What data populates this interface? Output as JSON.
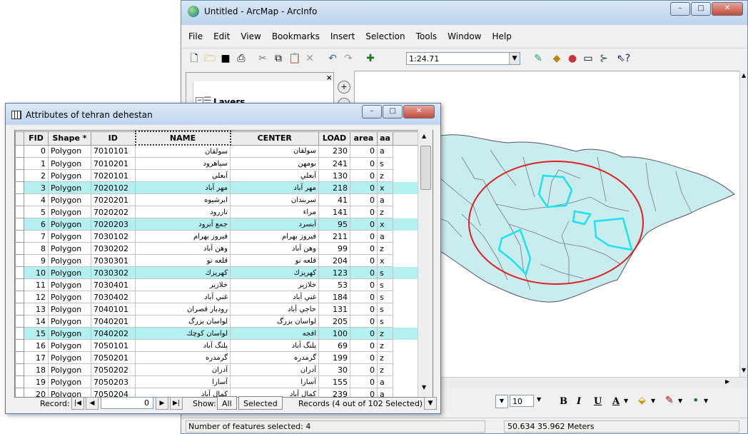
{
  "arcmap": {
    "title": "Untitled - ArcMap - ArcInfo",
    "window_buttons": [
      "–",
      "□",
      "✕"
    ],
    "menus": [
      "File",
      "Edit",
      "View",
      "Bookmarks",
      "Insert",
      "Selection",
      "Tools",
      "Window",
      "Help"
    ],
    "scale": "1:24.71",
    "toc_layers_label": "Layers",
    "font_size": "10",
    "format_bold": "B",
    "format_italic": "I",
    "format_underline": "U",
    "format_font_color": "A",
    "status_selected": "Number of features selected: 4",
    "status_coords": "50.634  35.962 Meters"
  },
  "attributes": {
    "title": "Attributes of tehran dehestan",
    "window_buttons": [
      "–",
      "□",
      "✕"
    ],
    "columns": [
      "FID",
      "Shape *",
      "ID",
      "NAME",
      "CENTER",
      "LOAD",
      "area",
      "aa"
    ],
    "rows": [
      {
        "fid": "0",
        "shape": "Polygon",
        "id": "7010101",
        "name": "سولقان",
        "center": "سولقان",
        "load": "230",
        "area": "0",
        "aa": "a",
        "hi": false
      },
      {
        "fid": "1",
        "shape": "Polygon",
        "id": "7010201",
        "name": "سیاهرود",
        "center": "بومهن",
        "load": "241",
        "area": "0",
        "aa": "s",
        "hi": false
      },
      {
        "fid": "2",
        "shape": "Polygon",
        "id": "7020101",
        "name": "آبعلي",
        "center": "آبعلي",
        "load": "130",
        "area": "0",
        "aa": "z",
        "hi": false
      },
      {
        "fid": "3",
        "shape": "Polygon",
        "id": "7020102",
        "name": "مهر آباد",
        "center": "مهر آباد",
        "load": "218",
        "area": "0",
        "aa": "x",
        "hi": true
      },
      {
        "fid": "4",
        "shape": "Polygon",
        "id": "7020201",
        "name": "ابرشیوه",
        "center": "سربندان",
        "load": "41",
        "area": "0",
        "aa": "a",
        "hi": false
      },
      {
        "fid": "5",
        "shape": "Polygon",
        "id": "7020202",
        "name": "تاررود",
        "center": "مراء",
        "load": "141",
        "area": "0",
        "aa": "z",
        "hi": false
      },
      {
        "fid": "6",
        "shape": "Polygon",
        "id": "7020203",
        "name": "جمع آبرود",
        "center": "آبسرد",
        "load": "95",
        "area": "0",
        "aa": "x",
        "hi": true
      },
      {
        "fid": "7",
        "shape": "Polygon",
        "id": "7030102",
        "name": "فیروز بهرام",
        "center": "فیروز بهرام",
        "load": "211",
        "area": "0",
        "aa": "a",
        "hi": false
      },
      {
        "fid": "8",
        "shape": "Polygon",
        "id": "7030202",
        "name": "وهن آباد",
        "center": "وهن آباد",
        "load": "99",
        "area": "0",
        "aa": "z",
        "hi": false
      },
      {
        "fid": "9",
        "shape": "Polygon",
        "id": "7030301",
        "name": "قلعه نو",
        "center": "قلعه نو",
        "load": "204",
        "area": "0",
        "aa": "x",
        "hi": false
      },
      {
        "fid": "10",
        "shape": "Polygon",
        "id": "7030302",
        "name": "كهريزك",
        "center": "كهريزك",
        "load": "123",
        "area": "0",
        "aa": "s",
        "hi": true
      },
      {
        "fid": "11",
        "shape": "Polygon",
        "id": "7030401",
        "name": "خلازير",
        "center": "خلازير",
        "load": "53",
        "area": "0",
        "aa": "s",
        "hi": false
      },
      {
        "fid": "12",
        "shape": "Polygon",
        "id": "7030402",
        "name": "غني آباد",
        "center": "غني آباد",
        "load": "184",
        "area": "0",
        "aa": "s",
        "hi": false
      },
      {
        "fid": "13",
        "shape": "Polygon",
        "id": "7040101",
        "name": "رودبار قصران",
        "center": "حاجي آباد",
        "load": "131",
        "area": "0",
        "aa": "s",
        "hi": false
      },
      {
        "fid": "14",
        "shape": "Polygon",
        "id": "7040201",
        "name": "لواسان بزرگ",
        "center": "لواسان بزرگ",
        "load": "205",
        "area": "0",
        "aa": "s",
        "hi": false
      },
      {
        "fid": "15",
        "shape": "Polygon",
        "id": "7040202",
        "name": "لواسان كوچك",
        "center": "افجه",
        "load": "100",
        "area": "0",
        "aa": "z",
        "hi": true
      },
      {
        "fid": "16",
        "shape": "Polygon",
        "id": "7050101",
        "name": "پلنگ آباد",
        "center": "پلنگ آباد",
        "load": "69",
        "area": "0",
        "aa": "z",
        "hi": false
      },
      {
        "fid": "17",
        "shape": "Polygon",
        "id": "7050201",
        "name": "گرمدره",
        "center": "گرمدره",
        "load": "199",
        "area": "0",
        "aa": "z",
        "hi": false
      },
      {
        "fid": "18",
        "shape": "Polygon",
        "id": "7050202",
        "name": "آدران",
        "center": "آدران",
        "load": "30",
        "area": "0",
        "aa": "z",
        "hi": false
      },
      {
        "fid": "19",
        "shape": "Polygon",
        "id": "7050203",
        "name": "آسارا",
        "center": "آسارا",
        "load": "155",
        "area": "0",
        "aa": "a",
        "hi": false
      },
      {
        "fid": "20",
        "shape": "Polygon",
        "id": "7050204",
        "name": "كمال آباد",
        "center": "كمال آباد",
        "load": "239",
        "area": "0",
        "aa": "a",
        "hi": false
      }
    ],
    "record_label": "Record:",
    "record_value": "0",
    "show_label": "Show:",
    "all_button": "All",
    "selected_button": "Selected",
    "records_summary": "Records (4 out of 102 Selected)",
    "highlight_color": "#b4f0f0"
  },
  "map": {
    "fill_color": "#c9ecef",
    "highlight_stroke": "#19e3ef",
    "circle_color": "#e02020"
  }
}
